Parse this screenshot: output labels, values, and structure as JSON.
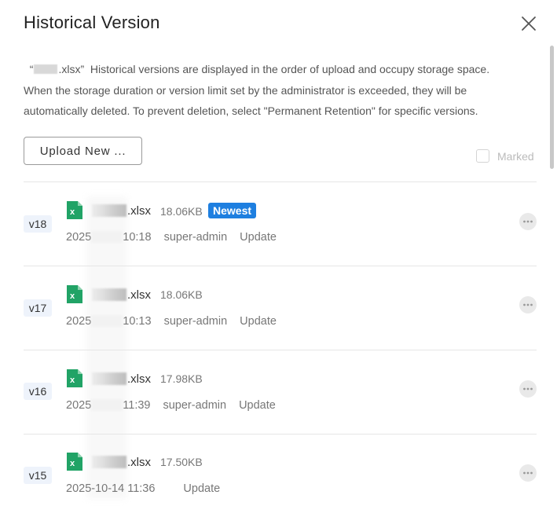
{
  "dialog": {
    "title": "Historical Version",
    "description_prefix": "“",
    "description_filename_suffix": ".xlsx”",
    "description_line1_rest": "  Historical versions are displayed in the order of upload and occupy storage space.",
    "description_line2": "When the storage duration or version limit set by the administrator is exceeded, they will be",
    "description_line3": "automatically deleted. To prevent deletion, select \"Permanent Retention\" for specific versions.",
    "upload_button_label": "Upload New ...",
    "marked_label": "Marked"
  },
  "versions": [
    {
      "tag": "v18",
      "filename_suffix": ".xlsx",
      "size": "18.06KB",
      "badge": "Newest",
      "date_prefix": "2025",
      "time_suffix": "10:18",
      "user": "super-admin",
      "action": "Update"
    },
    {
      "tag": "v17",
      "filename_suffix": ".xlsx",
      "size": "18.06KB",
      "badge": "",
      "date_prefix": "2025",
      "time_suffix": "10:13",
      "user": "super-admin",
      "action": "Update"
    },
    {
      "tag": "v16",
      "filename_suffix": ".xlsx",
      "size": "17.98KB",
      "badge": "",
      "date_prefix": "2025",
      "time_suffix": "11:39",
      "user": "super-admin",
      "action": "Update"
    },
    {
      "tag": "v15",
      "filename_suffix": ".xlsx",
      "size": "17.50KB",
      "badge": "",
      "datetime": "2025-10-14 11:36",
      "user": "",
      "action": "Update"
    }
  ],
  "icons": {
    "close": "close-icon",
    "excel": "excel-file-icon",
    "more": "more-options-icon"
  },
  "colors": {
    "badge": "#1e7fe0",
    "excel_green": "#21a366",
    "version_tag_bg": "#eef3fb"
  }
}
